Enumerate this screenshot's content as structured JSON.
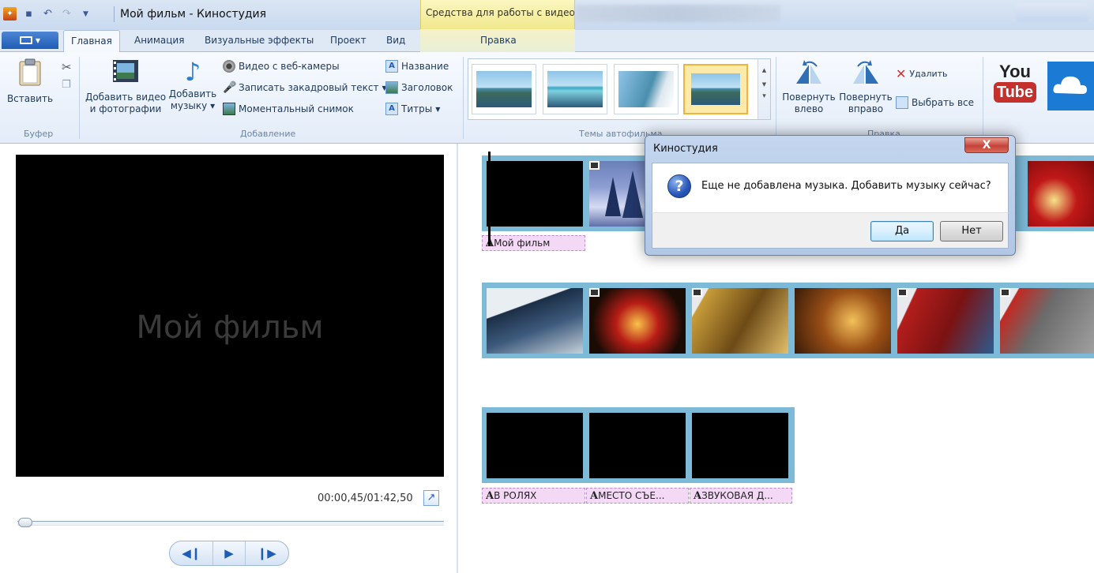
{
  "window": {
    "title": "Мой фильм - Киностудия",
    "context_group": "Средства для работы с видео"
  },
  "tabs": {
    "file": "",
    "items": [
      "Главная",
      "Анимация",
      "Визуальные эффекты",
      "Проект",
      "Вид"
    ],
    "context_tab": "Правка",
    "active": "Главная"
  },
  "ribbon": {
    "clipboard": {
      "paste": "Вставить",
      "group": "Буфер"
    },
    "add": {
      "add_video_line1": "Добавить видео",
      "add_video_line2": "и фотографии",
      "add_music_line1": "Добавить",
      "add_music_line2": "музыку",
      "webcam": "Видео с веб-камеры",
      "narration": "Записать закадровый текст",
      "snapshot": "Моментальный снимок",
      "title": "Название",
      "caption": "Заголовок",
      "credits": "Титры",
      "group": "Добавление"
    },
    "themes": {
      "group": "Темы автофильма"
    },
    "edit": {
      "rotate_left_line1": "Повернуть",
      "rotate_left_line2": "влево",
      "rotate_right_line1": "Повернуть",
      "rotate_right_line2": "вправо",
      "delete": "Удалить",
      "select_all": "Выбрать все",
      "group": "Правка"
    },
    "share": {
      "youtube_line1": "You",
      "youtube_line2": "Tube"
    }
  },
  "preview": {
    "title": "Мой фильм",
    "timecode": "00:00,45/01:42,50",
    "position": 0.0044
  },
  "storyboard": {
    "captions": {
      "first": "Мой фильм",
      "credits": [
        "В РОЛЯХ",
        "МЕСТО СЪЕ...",
        "ЗВУКОВАЯ Д..."
      ]
    }
  },
  "dialog": {
    "title": "Киностудия",
    "close": "X",
    "message": "Еще не добавлена музыка. Добавить музыку сейчас?",
    "yes": "Да",
    "no": "Нет"
  },
  "colors": {
    "accent": "#1f5cb5",
    "storyboard_strip": "#7cbad8",
    "caption_bg": "#f3d9f5",
    "context_tab": "#f1e88d",
    "youtube_red": "#c4302b"
  }
}
